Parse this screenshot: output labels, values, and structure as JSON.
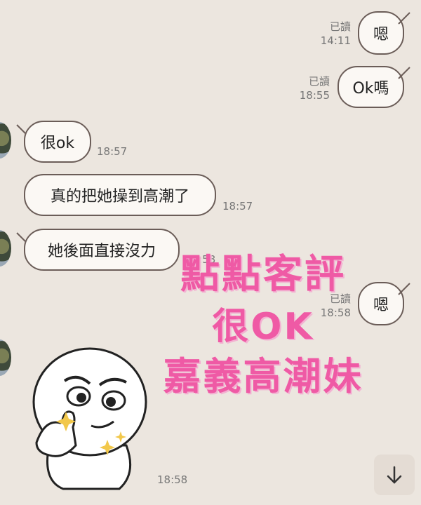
{
  "messages": [
    {
      "side": "right",
      "read": "已讀",
      "time": "14:11",
      "text": "嗯"
    },
    {
      "side": "right",
      "read": "已讀",
      "time": "18:55",
      "text": "Ok嗎"
    },
    {
      "side": "left",
      "time": "18:57",
      "text": "很ok"
    },
    {
      "side": "left",
      "time": "18:57",
      "text": "真的把她操到高潮了"
    },
    {
      "side": "left",
      "time": "18:58",
      "text": "她後面直接沒力"
    },
    {
      "side": "right",
      "read": "已讀",
      "time": "18:58",
      "text": "嗯"
    },
    {
      "side": "left",
      "time": "18:58",
      "sticker": "smug-face-sticker"
    }
  ],
  "overlay": {
    "line1": "點點客評",
    "line2": "很OK",
    "line3": "嘉義高潮妹",
    "color": "#ef5aa5"
  },
  "icons": {
    "scroll_down": "arrow-down-icon"
  }
}
